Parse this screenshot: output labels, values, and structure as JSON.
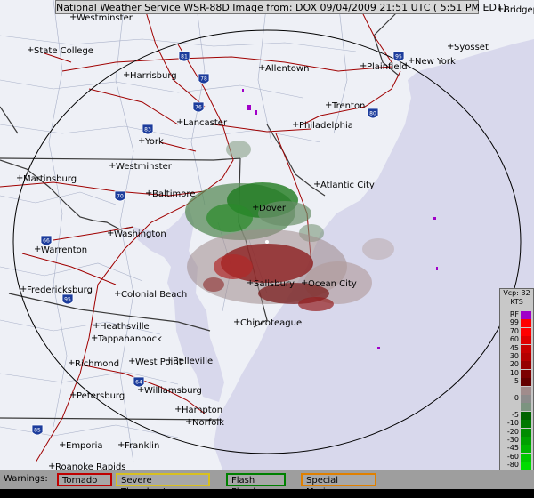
{
  "header": {
    "title": "National Weather Service WSR-88D Image from: DOX 09/04/2009 21:51 UTC  ( 5:51 PM EDT)"
  },
  "map": {
    "cities": [
      "Westminster",
      "Bridgeport",
      "State College",
      "Syosset",
      "Allentown",
      "Plainfield",
      "New York",
      "Harrisburg",
      "Trenton",
      "Lancaster",
      "Philadelphia",
      "York",
      "Westminster",
      "Martinsburg",
      "Atlantic City",
      "Baltimore",
      "Dover",
      "Washington",
      "Warrenton",
      "Salisbury",
      "Ocean City",
      "Fredericksburg",
      "Colonial Beach",
      "Heathsville",
      "Tappahannock",
      "Chincoteague",
      "Richmond",
      "West Point",
      "Belleville",
      "Williamsburg",
      "Petersburg",
      "Hampton",
      "Norfolk",
      "Emporia",
      "Franklin",
      "Roanoke Rapids"
    ],
    "interstate_shields": [
      "81",
      "78",
      "76",
      "95",
      "83",
      "70",
      "66",
      "95",
      "64",
      "85",
      "80"
    ]
  },
  "legend": {
    "mode": "Vcp: 32",
    "units": "KTS",
    "rows": [
      {
        "label": "RF",
        "color": "#a000c8"
      },
      {
        "label": "99",
        "color": "#ff0000"
      },
      {
        "label": "70",
        "color": "#ff0000"
      },
      {
        "label": "60",
        "color": "#e00000"
      },
      {
        "label": "45",
        "color": "#c80000"
      },
      {
        "label": "30",
        "color": "#b40000"
      },
      {
        "label": "20",
        "color": "#960000"
      },
      {
        "label": "10",
        "color": "#7c0000"
      },
      {
        "label": "5",
        "color": "#640000"
      },
      {
        "label": "",
        "color": "#a08c8c"
      },
      {
        "label": "0",
        "color": "#8c8c8c"
      },
      {
        "label": "",
        "color": "#7c9480"
      },
      {
        "label": "-5",
        "color": "#006400"
      },
      {
        "label": "-10",
        "color": "#007800"
      },
      {
        "label": "-20",
        "color": "#008c00"
      },
      {
        "label": "-30",
        "color": "#00a000"
      },
      {
        "label": "-45",
        "color": "#00b400"
      },
      {
        "label": "-60",
        "color": "#00c800"
      },
      {
        "label": "-80",
        "color": "#00dc00"
      },
      {
        "label": "-99",
        "color": "#00ff00"
      },
      {
        "label": "ND",
        "color": "#c8c8c8"
      }
    ]
  },
  "warnings": {
    "label": "Warnings:",
    "items": [
      {
        "text": "Tornado",
        "color": "#c00000"
      },
      {
        "text": "Severe Thunderstorm",
        "color": "#d8c020"
      },
      {
        "text": "Flash Flood",
        "color": "#008000"
      },
      {
        "text": "Special Marine",
        "color": "#e08000"
      }
    ]
  },
  "colors": {
    "land": "#eef0f6",
    "ocean": "#d8d8ec",
    "county_lines": "#a0a8c0",
    "state_lines": "#3c3c3c",
    "highways": "#a00000",
    "range_ring": "#000000"
  }
}
